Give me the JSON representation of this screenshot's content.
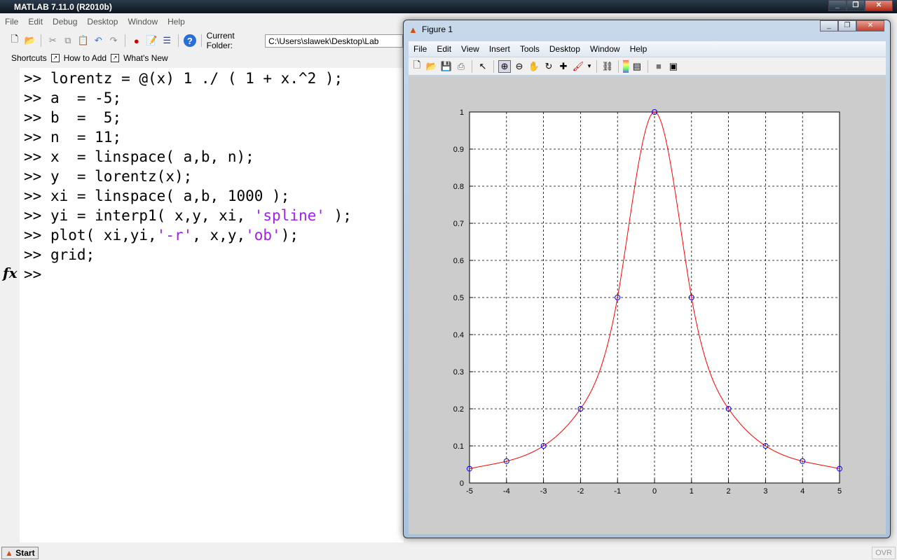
{
  "app": {
    "title": "MATLAB  7.11.0 (R2010b)"
  },
  "main_menu": [
    "File",
    "Edit",
    "Debug",
    "Desktop",
    "Window",
    "Help"
  ],
  "toolbar": {
    "current_folder_label": "Current Folder:",
    "current_folder_value": "C:\\Users\\slawek\\Desktop\\Lab"
  },
  "shortcuts": {
    "label": "Shortcuts",
    "items": [
      "How to Add",
      "What's New"
    ]
  },
  "command_window": {
    "prompt": ">>",
    "fx": "fx",
    "lines": [
      [
        {
          "t": "lorentz = @(x) 1 ./ ( 1 + x.^2 );"
        }
      ],
      [
        {
          "t": "a  = -5;"
        }
      ],
      [
        {
          "t": "b  =  5;"
        }
      ],
      [
        {
          "t": "n  = 11;"
        }
      ],
      [
        {
          "t": "x  = linspace( a,b, n);"
        }
      ],
      [
        {
          "t": "y  = lorentz(x);"
        }
      ],
      [
        {
          "t": "xi = linspace( a,b, 1000 );"
        }
      ],
      [
        {
          "t": "yi = interp1( x,y, xi, "
        },
        {
          "t": "'spline'",
          "s": 1
        },
        {
          "t": " );"
        }
      ],
      [
        {
          "t": "plot( xi,yi,"
        },
        {
          "t": "'-r'",
          "s": 1
        },
        {
          "t": ", x,y,"
        },
        {
          "t": "'ob'",
          "s": 1
        },
        {
          "t": ");"
        }
      ],
      [
        {
          "t": "grid;"
        }
      ],
      []
    ],
    "string_color": "#a020f0"
  },
  "status": {
    "start": "Start",
    "ovr": "OVR"
  },
  "figure": {
    "title": "Figure 1",
    "menu": [
      "File",
      "Edit",
      "View",
      "Insert",
      "Tools",
      "Desktop",
      "Window",
      "Help"
    ]
  },
  "chart_data": {
    "type": "line",
    "xlim": [
      -5,
      5
    ],
    "ylim": [
      0,
      1
    ],
    "grid": true,
    "xticks": [
      "-5",
      "-4",
      "-3",
      "-2",
      "-1",
      "0",
      "1",
      "2",
      "3",
      "4",
      "5"
    ],
    "yticks": [
      "0",
      "0.1",
      "0.2",
      "0.3",
      "0.4",
      "0.5",
      "0.6",
      "0.7",
      "0.8",
      "0.9",
      "1"
    ],
    "series": [
      {
        "style": "spline interpolation line",
        "color": "#ff0000",
        "x": [
          -5,
          -4,
          -3,
          -2,
          -1,
          0,
          1,
          2,
          3,
          4,
          5
        ],
        "y": [
          0.0385,
          0.0588,
          0.1,
          0.2,
          0.5,
          1,
          0.5,
          0.2,
          0.1,
          0.0588,
          0.0385
        ]
      },
      {
        "style": "circle markers",
        "color": "#0000ff",
        "x": [
          -5,
          -4,
          -3,
          -2,
          -1,
          0,
          1,
          2,
          3,
          4,
          5
        ],
        "y": [
          0.0385,
          0.0588,
          0.1,
          0.2,
          0.5,
          1,
          0.5,
          0.2,
          0.1,
          0.0588,
          0.0385
        ]
      }
    ]
  }
}
